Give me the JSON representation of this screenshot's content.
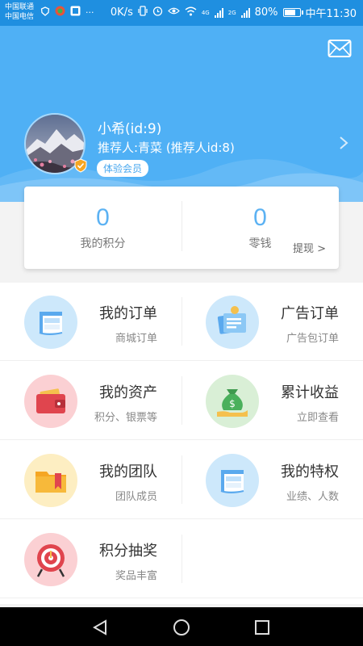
{
  "status_bar": {
    "carrier1": "中国联通",
    "carrier2": "中国电信",
    "more": "···",
    "speed": "0K/s",
    "network1": "4G",
    "network2": "2G",
    "battery": "80%",
    "battery_level": 0.8,
    "time": "中午11:30"
  },
  "header": {
    "username": "小希(id:9)",
    "referrer": "推荐人:青菜 (推荐人id:8)",
    "badge": "体验会员",
    "bg_color": "#4fb0f5"
  },
  "points": {
    "points_value": "0",
    "points_label": "我的积分",
    "change_value": "0",
    "change_label": "零钱",
    "withdraw": "提现 >",
    "accent": "#5cb2f3"
  },
  "menu": [
    {
      "title": "我的订单",
      "sub": "商城订单",
      "icon": "orders-icon",
      "icon_bg": "#cde8fb"
    },
    {
      "title": "广告订单",
      "sub": "广告包订单",
      "icon": "ad-orders-icon",
      "icon_bg": "#cde8fb"
    },
    {
      "title": "我的资产",
      "sub": "积分、银票等",
      "icon": "wallet-icon",
      "icon_bg": "#fbd0d3"
    },
    {
      "title": "累计收益",
      "sub": "立即查看",
      "icon": "money-bag-icon",
      "icon_bg": "#d9efd6"
    },
    {
      "title": "我的团队",
      "sub": "团队成员",
      "icon": "folder-icon",
      "icon_bg": "#fdeec2"
    },
    {
      "title": "我的特权",
      "sub": "业绩、人数",
      "icon": "privilege-icon",
      "icon_bg": "#cde8fb"
    },
    {
      "title": "积分抽奖",
      "sub": "奖品丰富",
      "icon": "target-icon",
      "icon_bg": "#fbd0d3"
    }
  ]
}
